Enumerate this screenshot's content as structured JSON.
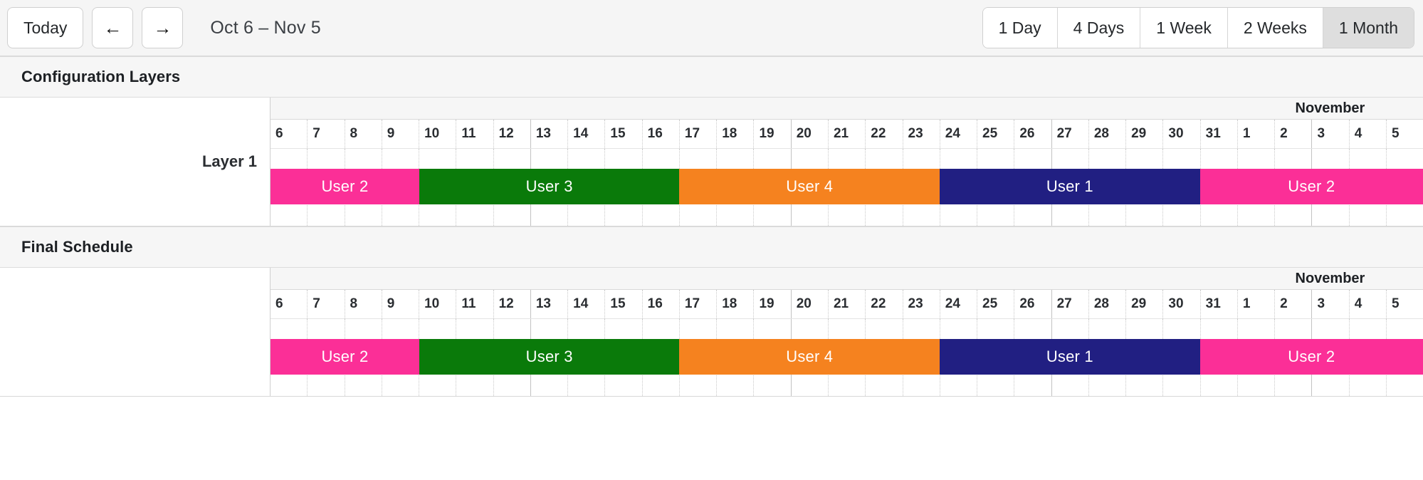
{
  "toolbar": {
    "today_label": "Today",
    "prev_icon": "arrow-left-icon",
    "prev_glyph": "←",
    "next_icon": "arrow-right-icon",
    "next_glyph": "→",
    "date_range": "Oct 6 – Nov 5",
    "views": [
      {
        "label": "1 Day",
        "active": false
      },
      {
        "label": "4 Days",
        "active": false
      },
      {
        "label": "1 Week",
        "active": false
      },
      {
        "label": "2 Weeks",
        "active": false
      },
      {
        "label": "1 Month",
        "active": true
      }
    ]
  },
  "colors": {
    "user1": "#211f82",
    "user2": "#fb2f97",
    "user3": "#0a7a0a",
    "user4": "#f5821f",
    "toolbar_bg": "#f5f5f5",
    "section_header_bg": "#f6f6f6",
    "active_segment_bg": "#dedede",
    "border": "#d8d8d8"
  },
  "calendar": {
    "days": [
      "6",
      "7",
      "8",
      "9",
      "10",
      "11",
      "12",
      "13",
      "14",
      "15",
      "16",
      "17",
      "18",
      "19",
      "20",
      "21",
      "22",
      "23",
      "24",
      "25",
      "26",
      "27",
      "28",
      "29",
      "30",
      "31",
      "1",
      "2",
      "3",
      "4",
      "5"
    ],
    "week_start_indices": [
      7,
      14,
      21,
      28
    ],
    "month_label": "November",
    "month_label_start_index": 26,
    "month_label_span": 5,
    "total_days": 31
  },
  "sections": [
    {
      "title": "Configuration Layers",
      "row_label": "Layer 1",
      "events": [
        {
          "label": "User 2",
          "color_key": "user2",
          "start_index": 0,
          "span": 4
        },
        {
          "label": "User 3",
          "color_key": "user3",
          "start_index": 4,
          "span": 7
        },
        {
          "label": "User 4",
          "color_key": "user4",
          "start_index": 11,
          "span": 7
        },
        {
          "label": "User 1",
          "color_key": "user1",
          "start_index": 18,
          "span": 7
        },
        {
          "label": "User 2",
          "color_key": "user2",
          "start_index": 25,
          "span": 6
        }
      ]
    },
    {
      "title": "Final Schedule",
      "row_label": "",
      "events": [
        {
          "label": "User 2",
          "color_key": "user2",
          "start_index": 0,
          "span": 4
        },
        {
          "label": "User 3",
          "color_key": "user3",
          "start_index": 4,
          "span": 7
        },
        {
          "label": "User 4",
          "color_key": "user4",
          "start_index": 11,
          "span": 7
        },
        {
          "label": "User 1",
          "color_key": "user1",
          "start_index": 18,
          "span": 7
        },
        {
          "label": "User 2",
          "color_key": "user2",
          "start_index": 25,
          "span": 6
        }
      ]
    }
  ]
}
